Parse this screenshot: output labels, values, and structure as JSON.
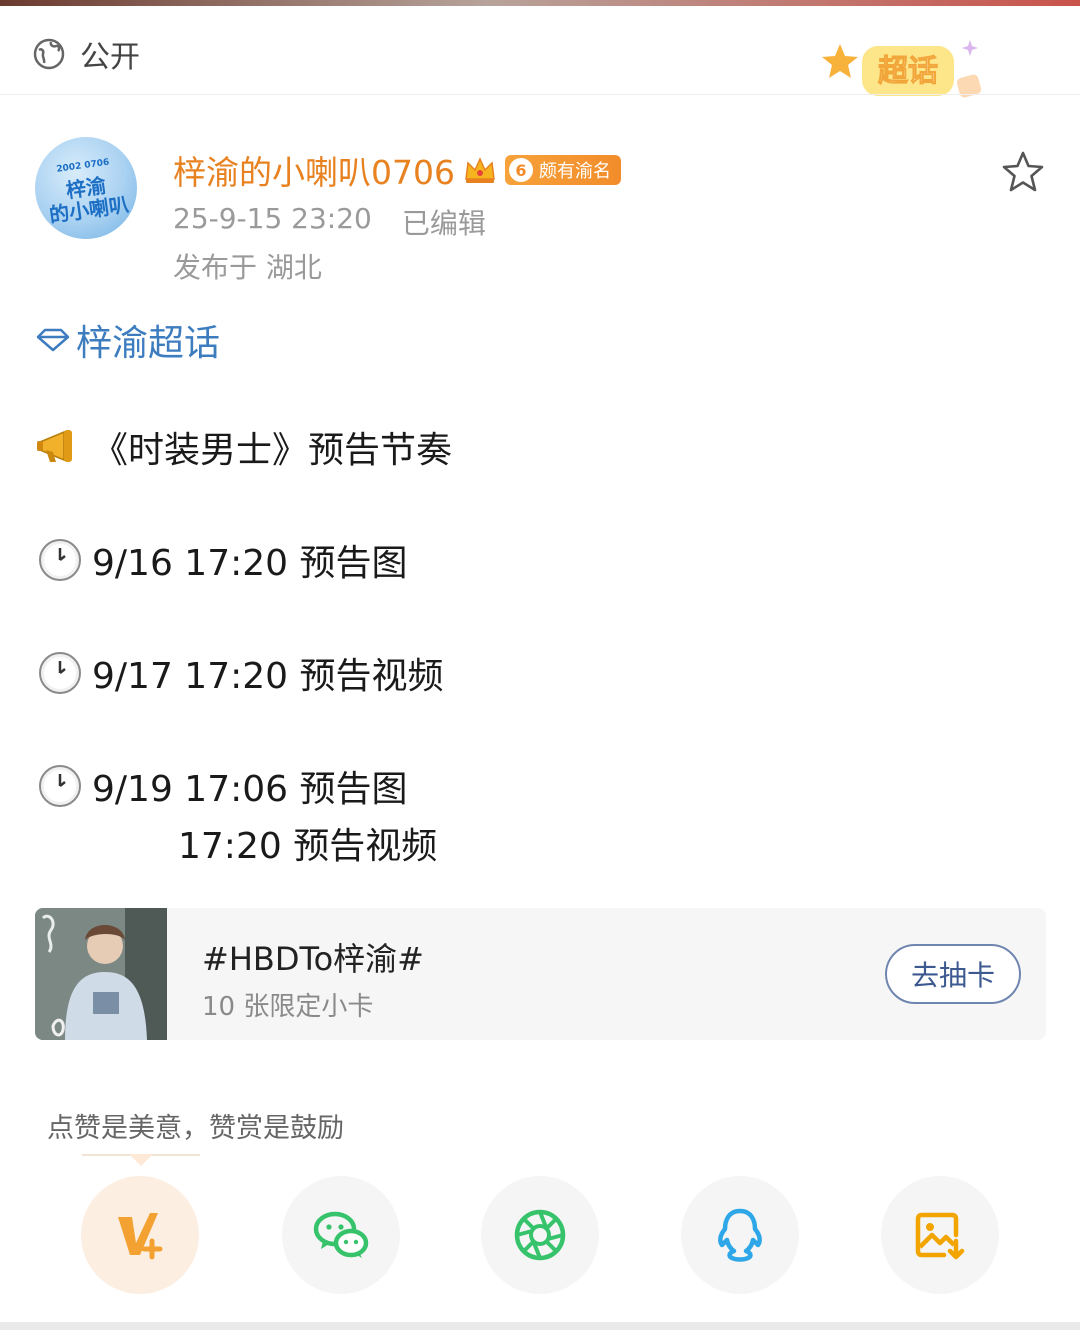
{
  "header": {
    "visibility_label": "公开",
    "supertopic_badge": "超话"
  },
  "author": {
    "name": "梓渝的小喇叭0706",
    "avatar_text_line1": "梓渝",
    "avatar_text_line2": "的小喇叭",
    "avatar_small": "2002 0706",
    "level": "6",
    "level_badge_label": "颇有渝名",
    "timestamp": "25-9-15 23:20",
    "edited": "已编辑",
    "location": "发布于 湖北"
  },
  "post": {
    "topic": "梓渝超话",
    "lines": [
      "《时装男士》预告节奏",
      "9/16 17:20 预告图",
      "9/17 17:20 预告视频",
      "9/19 17:06 预告图",
      "17:20 预告视频"
    ]
  },
  "promo": {
    "title": "#HBDTo梓渝#",
    "subtitle": "10 张限定小卡",
    "button_label": "去抽卡"
  },
  "praise_hint": "点赞是美意，赞赏是鼓励",
  "share": [
    {
      "icon": "weibo-vplus-icon"
    },
    {
      "icon": "wechat-icon"
    },
    {
      "icon": "moments-icon"
    },
    {
      "icon": "qq-icon"
    },
    {
      "icon": "save-image-icon"
    }
  ],
  "colors": {
    "author_orange": "#e8811f",
    "topic_blue": "#3d7dbf",
    "wechat_green": "#37c36b",
    "qq_blue": "#2ea7e8",
    "save_orange": "#f2a400"
  }
}
